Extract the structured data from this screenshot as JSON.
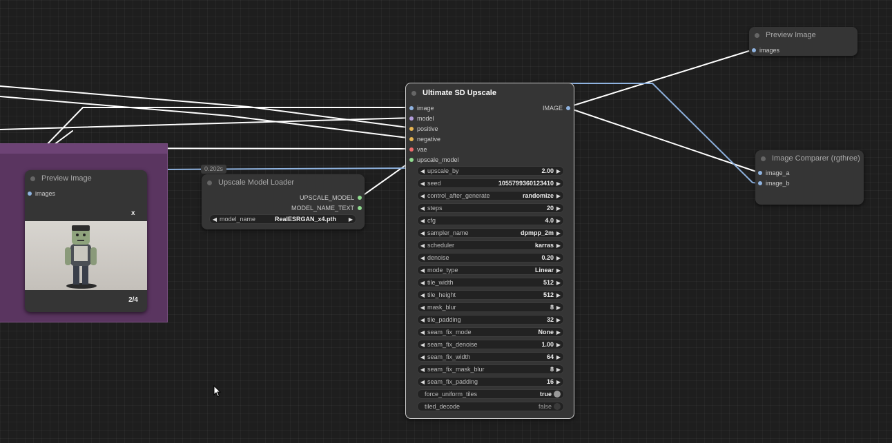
{
  "colors": {
    "image": "#8fb3e0",
    "model": "#b39ddb",
    "positive": "#e6b450",
    "negative": "#e6b450",
    "vae": "#ef6b6b",
    "upscale_model": "#8fdb8f",
    "output": "#8fb3e0",
    "group": "#5a3560"
  },
  "preview_right": {
    "title": "Preview Image",
    "input": "images"
  },
  "comparer": {
    "title": "Image Comparer (rgthree)",
    "inputs": [
      "image_a",
      "image_b"
    ]
  },
  "preview_left": {
    "title": "Preview Image",
    "input": "images",
    "close": "x",
    "counter": "2/4"
  },
  "badge": "0.202s",
  "loader": {
    "title": "Upscale Model Loader",
    "outputs": [
      "UPSCALE_MODEL",
      "MODEL_NAME_TEXT"
    ],
    "widget": {
      "label": "model_name",
      "value": "RealESRGAN_x4.pth"
    }
  },
  "usd": {
    "title": "Ultimate SD Upscale",
    "inputs": [
      "image",
      "model",
      "positive",
      "negative",
      "vae",
      "upscale_model"
    ],
    "output": "IMAGE",
    "widgets": [
      {
        "label": "upscale_by",
        "value": "2.00"
      },
      {
        "label": "seed",
        "value": "1055799360123410"
      },
      {
        "label": "control_after_generate",
        "value": "randomize"
      },
      {
        "label": "steps",
        "value": "20"
      },
      {
        "label": "cfg",
        "value": "4.0"
      },
      {
        "label": "sampler_name",
        "value": "dpmpp_2m"
      },
      {
        "label": "scheduler",
        "value": "karras"
      },
      {
        "label": "denoise",
        "value": "0.20"
      },
      {
        "label": "mode_type",
        "value": "Linear"
      },
      {
        "label": "tile_width",
        "value": "512"
      },
      {
        "label": "tile_height",
        "value": "512"
      },
      {
        "label": "mask_blur",
        "value": "8"
      },
      {
        "label": "tile_padding",
        "value": "32"
      },
      {
        "label": "seam_fix_mode",
        "value": "None"
      },
      {
        "label": "seam_fix_denoise",
        "value": "1.00"
      },
      {
        "label": "seam_fix_width",
        "value": "64"
      },
      {
        "label": "seam_fix_mask_blur",
        "value": "8"
      },
      {
        "label": "seam_fix_padding",
        "value": "16"
      }
    ],
    "toggles": [
      {
        "label": "force_uniform_tiles",
        "value": "true",
        "on": true
      },
      {
        "label": "tiled_decode",
        "value": "false",
        "on": false
      }
    ]
  }
}
